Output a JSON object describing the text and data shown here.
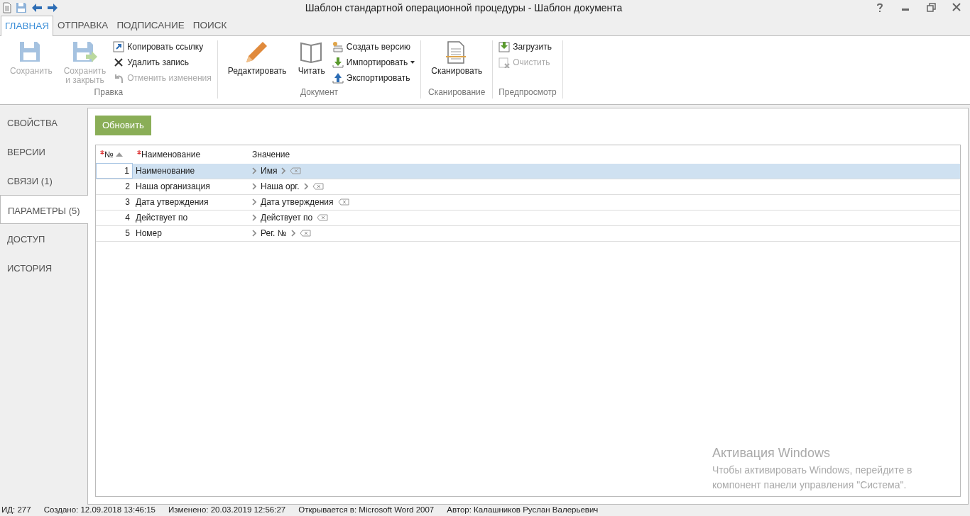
{
  "window": {
    "title": "Шаблон стандартной операционной процедуры - Шаблон документа"
  },
  "ribbon_tabs": [
    {
      "label": "ГЛАВНАЯ",
      "selected": true
    },
    {
      "label": "ОТПРАВКА",
      "selected": false
    },
    {
      "label": "ПОДПИСАНИЕ",
      "selected": false
    },
    {
      "label": "ПОИСК",
      "selected": false
    }
  ],
  "ribbon_groups": [
    {
      "label": "Правка",
      "items": [
        {
          "kind": "large",
          "label": "Сохранить",
          "disabled": true
        },
        {
          "kind": "large",
          "label": "Сохранить\nи закрыть",
          "disabled": true
        },
        {
          "kind": "stack",
          "items": [
            {
              "label": "Копировать ссылку",
              "disabled": false
            },
            {
              "label": "Удалить запись",
              "disabled": false
            },
            {
              "label": "Отменить изменения",
              "disabled": true
            }
          ]
        }
      ]
    },
    {
      "label": "Документ",
      "items": [
        {
          "kind": "large",
          "label": "Редактировать",
          "disabled": false
        },
        {
          "kind": "large",
          "label": "Читать",
          "disabled": false
        },
        {
          "kind": "stack",
          "items": [
            {
              "label": "Создать версию",
              "disabled": false
            },
            {
              "label": "Импортировать",
              "disabled": false,
              "dropdown": true
            },
            {
              "label": "Экспортировать",
              "disabled": false
            }
          ]
        }
      ]
    },
    {
      "label": "Сканирование",
      "items": [
        {
          "kind": "large",
          "label": "Сканировать",
          "disabled": false
        }
      ]
    },
    {
      "label": "Предпросмотр",
      "items": [
        {
          "kind": "stack",
          "items": [
            {
              "label": "Загрузить",
              "disabled": false
            },
            {
              "label": "Очистить",
              "disabled": true
            }
          ]
        }
      ]
    }
  ],
  "sidebar": {
    "items": [
      {
        "label": "СВОЙСТВА",
        "selected": false
      },
      {
        "label": "ВЕРСИИ",
        "selected": false
      },
      {
        "label": "СВЯЗИ (1)",
        "selected": false
      },
      {
        "label": "ПАРАМЕТРЫ (5)",
        "selected": true
      },
      {
        "label": "ДОСТУП",
        "selected": false
      },
      {
        "label": "ИСТОРИЯ",
        "selected": false
      }
    ]
  },
  "refresh_button": "Обновить",
  "table": {
    "columns": [
      {
        "label": "№",
        "required": true,
        "sorted": true
      },
      {
        "label": "Наименование",
        "required": true,
        "sorted": false
      },
      {
        "label": "Значение",
        "required": false,
        "sorted": false
      }
    ],
    "rows": [
      {
        "number": "1",
        "name": "Наименование",
        "value": "Имя",
        "has_link": true,
        "selected": true
      },
      {
        "number": "2",
        "name": "Наша организация",
        "value": "Наша орг.",
        "has_link": true,
        "selected": false
      },
      {
        "number": "3",
        "name": "Дата утверждения",
        "value": "Дата утверждения",
        "has_link": false,
        "selected": false
      },
      {
        "number": "4",
        "name": "Действует по",
        "value": "Действует по",
        "has_link": false,
        "selected": false
      },
      {
        "number": "5",
        "name": "Номер",
        "value": "Рег. №",
        "has_link": true,
        "selected": false
      }
    ]
  },
  "activation_notice": {
    "title": "Активация Windows",
    "text": "Чтобы активировать Windows, перейдите в компонент панели управления \"Система\"."
  },
  "status_bar": [
    "ИД: 277",
    "Создано: 12.09.2018 13:46:15",
    "Изменено: 20.03.2019 12:56:27",
    "Открывается в: Microsoft Word 2007",
    "Автор: Калашников Руслан Валерьевич"
  ]
}
